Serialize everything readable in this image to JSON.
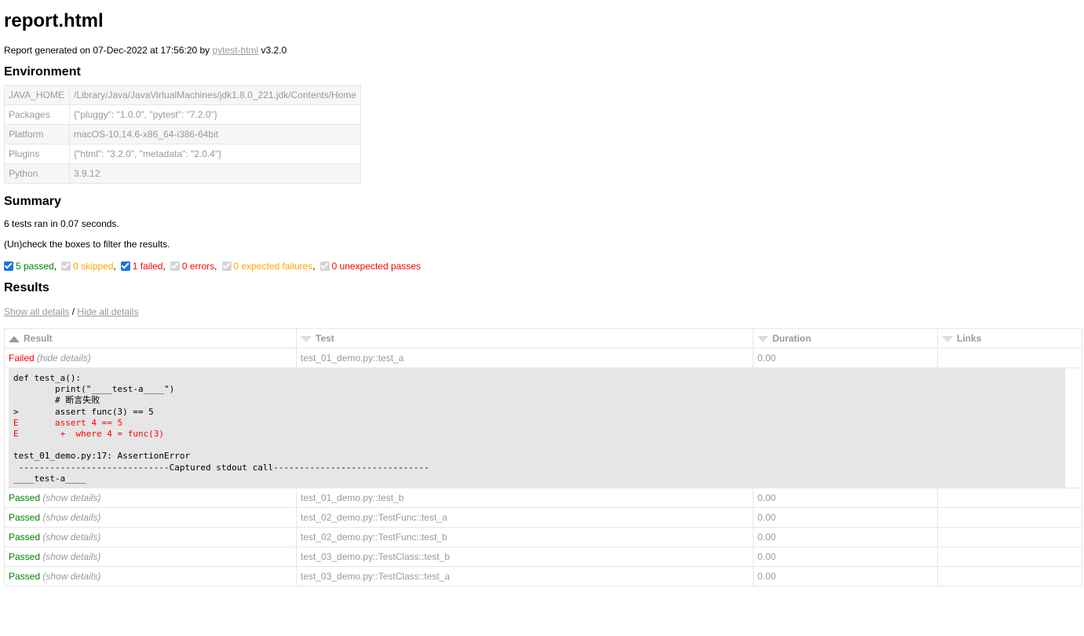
{
  "title": "report.html",
  "generated": {
    "prefix": "Report generated on 07-Dec-2022 at 17:56:20 by ",
    "link": "pytest-html",
    "suffix": " v3.2.0"
  },
  "environment": {
    "heading": "Environment",
    "rows": [
      {
        "key": "JAVA_HOME",
        "value": "/Library/Java/JavaVirtualMachines/jdk1.8.0_221.jdk/Contents/Home"
      },
      {
        "key": "Packages",
        "value": "{\"pluggy\": \"1.0.0\", \"pytest\": \"7.2.0\"}"
      },
      {
        "key": "Platform",
        "value": "macOS-10.14.6-x86_64-i386-64bit"
      },
      {
        "key": "Plugins",
        "value": "{\"html\": \"3.2.0\", \"metadata\": \"2.0.4\"}"
      },
      {
        "key": "Python",
        "value": "3.9.12"
      }
    ]
  },
  "summary": {
    "heading": "Summary",
    "ran": "6 tests ran in 0.07 seconds.",
    "hint": "(Un)check the boxes to filter the results.",
    "filters": [
      {
        "label": "5 passed",
        "checked": true,
        "color": "#008000"
      },
      {
        "label": "0 skipped",
        "checked": false,
        "color": "#ffa500"
      },
      {
        "label": "1 failed",
        "checked": true,
        "color": "#ff0000"
      },
      {
        "label": "0 errors",
        "checked": false,
        "color": "#ff0000"
      },
      {
        "label": "0 expected failures",
        "checked": false,
        "color": "#ffa500"
      },
      {
        "label": "0 unexpected passes",
        "checked": false,
        "color": "#ff0000"
      }
    ]
  },
  "results": {
    "heading": "Results",
    "show_all": "Show all details",
    "divider": " / ",
    "hide_all": "Hide all details",
    "columns": [
      "Result",
      "Test",
      "Duration",
      "Links"
    ],
    "rows": [
      {
        "result": "Failed",
        "details": "(hide details)",
        "test": "test_01_demo.py::test_a",
        "duration": "0.00",
        "links": ""
      },
      {
        "result": "Passed",
        "details": "(show details)",
        "test": "test_01_demo.py::test_b",
        "duration": "0.00",
        "links": ""
      },
      {
        "result": "Passed",
        "details": "(show details)",
        "test": "test_02_demo.py::TestFunc::test_a",
        "duration": "0.00",
        "links": ""
      },
      {
        "result": "Passed",
        "details": "(show details)",
        "test": "test_02_demo.py::TestFunc::test_b",
        "duration": "0.00",
        "links": ""
      },
      {
        "result": "Passed",
        "details": "(show details)",
        "test": "test_03_demo.py::TestClass::test_b",
        "duration": "0.00",
        "links": ""
      },
      {
        "result": "Passed",
        "details": "(show details)",
        "test": "test_03_demo.py::TestClass::test_a",
        "duration": "0.00",
        "links": ""
      }
    ],
    "log": [
      {
        "text": "def test_a():",
        "error": false
      },
      {
        "text": "        print(\"____test-a____\")",
        "error": false
      },
      {
        "text": "        # 断言失败",
        "error": false
      },
      {
        "text": ">       assert func(3) == 5",
        "error": false
      },
      {
        "text": "E       assert 4 == 5",
        "error": true
      },
      {
        "text": "E        +  where 4 = func(3)",
        "error": true
      },
      {
        "text": "",
        "error": false
      },
      {
        "text": "test_01_demo.py:17: AssertionError",
        "error": false
      },
      {
        "text": " -----------------------------Captured stdout call------------------------------",
        "error": false
      },
      {
        "text": "____test-a____",
        "error": false
      }
    ]
  }
}
